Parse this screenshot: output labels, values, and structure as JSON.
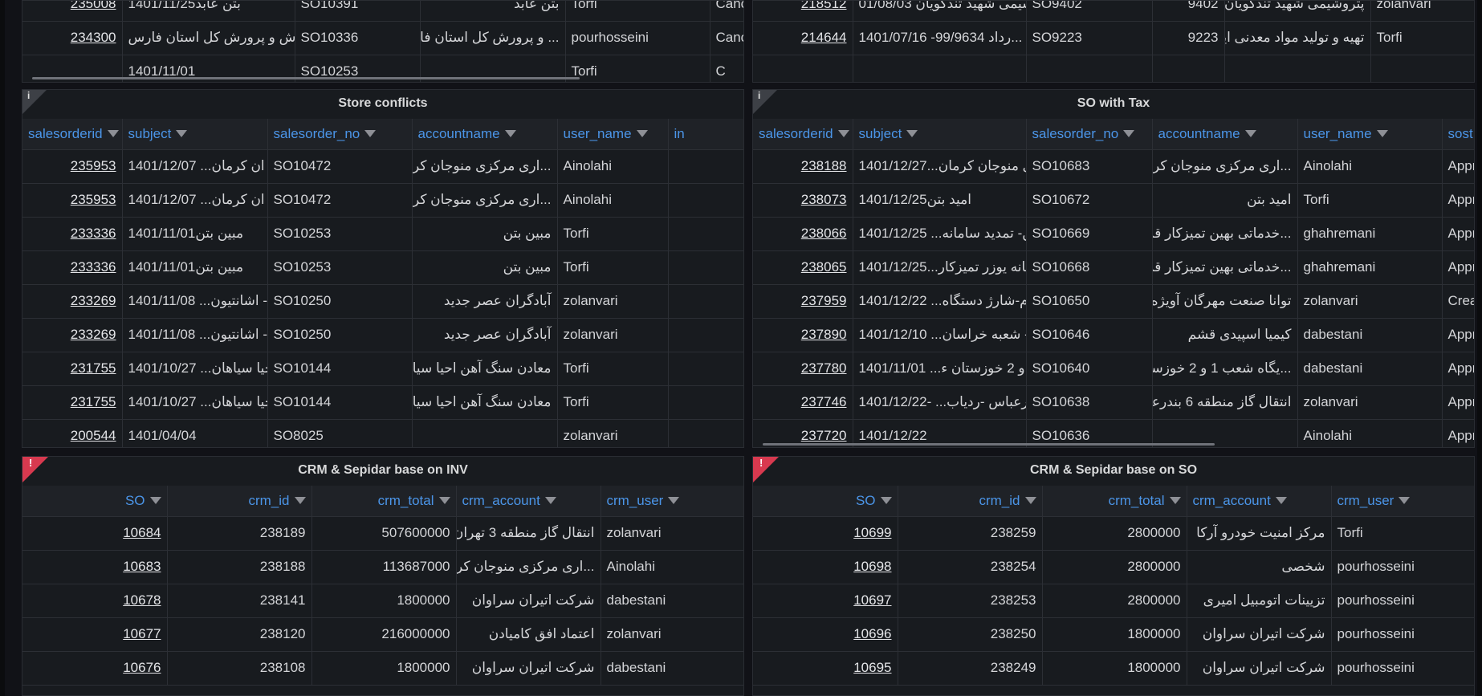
{
  "panels": {
    "top_left_partial": {
      "rows": [
        {
          "id": "235008",
          "subject": "1401/11/25بتن عابد",
          "so": "SO10391",
          "account": "بتن عابد",
          "user": "Torfi",
          "status": "Canc"
        },
        {
          "id": "234300",
          "subject": "آموزش و پرورش کل استان فارس...",
          "so": "SO10336",
          "account": "... و پرورش کل استان فارس",
          "user": "pourhosseini",
          "status": "Canc"
        },
        {
          "id": "",
          "subject": "1401/11/01",
          "so": "SO10253",
          "account": "",
          "user": "Torfi",
          "status": "C"
        }
      ]
    },
    "top_right_partial": {
      "rows": [
        {
          "id": "218512",
          "subject": "01/08/03 شیمی شهید تندگویان...",
          "so": "SO9402",
          "num": "9402",
          "account": "پتروشیمی شهید تندگویان",
          "user": "zolanvari"
        },
        {
          "id": "214644",
          "subject": "1401/07/16 -99/9634 رداد...",
          "so": "SO9223",
          "num": "9223",
          "account": "تهیه و تولید مواد معدنی ایران",
          "user": "Torfi"
        },
        {
          "id": "",
          "subject": "",
          "so": "",
          "num": "",
          "account": "",
          "user": ""
        }
      ]
    },
    "store_conflicts": {
      "title": "Store conflicts",
      "info_glyph": "i",
      "columns": [
        "salesorderid",
        "subject",
        "salesorder_no",
        "accountname",
        "user_name",
        "in"
      ],
      "rows": [
        {
          "id": "235953",
          "subject": "1401/12/07 ...ان کرمان",
          "so": "SO10472",
          "account": "...اری مرکزی منوجان کرمان",
          "user": "Ainolahi"
        },
        {
          "id": "235953",
          "subject": "1401/12/07 ...ان کرمان",
          "so": "SO10472",
          "account": "...اری مرکزی منوجان کرمان",
          "user": "Ainolahi"
        },
        {
          "id": "233336",
          "subject": "1401/11/01مبین بتن",
          "so": "SO10253",
          "account": "مبین بتن",
          "user": "Torfi"
        },
        {
          "id": "233336",
          "subject": "1401/11/01مبین بتن",
          "so": "SO10253",
          "account": "مبین بتن",
          "user": "Torfi"
        },
        {
          "id": "233269",
          "subject": "1401/11/08 ...د- اشانتیون",
          "so": "SO10250",
          "account": "آبادگران عصر جدید",
          "user": "zolanvari"
        },
        {
          "id": "233269",
          "subject": "1401/11/08 ...د- اشانتیون",
          "so": "SO10250",
          "account": "آبادگران عصر جدید",
          "user": "zolanvari"
        },
        {
          "id": "231755",
          "subject": "1401/10/27 ...حیا سیاهان",
          "so": "SO10144",
          "account": "معادن سنگ آهن احیا سیاهان",
          "user": "Torfi"
        },
        {
          "id": "231755",
          "subject": "1401/10/27 ...حیا سیاهان",
          "so": "SO10144",
          "account": "معادن سنگ آهن احیا سیاهان",
          "user": "Torfi"
        },
        {
          "id": "200544",
          "subject": "1401/04/04",
          "so": "SO8025",
          "account": "",
          "user": "zolanvari"
        }
      ]
    },
    "so_with_tax": {
      "title": "SO with Tax",
      "info_glyph": "i",
      "columns": [
        "salesorderid",
        "subject",
        "salesorder_no",
        "accountname",
        "user_name",
        "sost"
      ],
      "rows": [
        {
          "id": "238188",
          "subject": "1401/12/27...ی منوجان کرمان",
          "so": "SO10683",
          "account": "...اری مرکزی منوجان کرمان",
          "user": "Ainolahi",
          "status": "Appr"
        },
        {
          "id": "238073",
          "subject": "1401/12/25امید بتن",
          "so": "SO10672",
          "account": "امید بتن",
          "user": "Torfi",
          "status": "Appr"
        },
        {
          "id": "238066",
          "subject": "1401/12/25 ...وین- تمدید سامانه",
          "so": "SO10669",
          "account": "...خدماتی بهین تمیزکار قزوین",
          "user": "ghahremani",
          "status": "Appr"
        },
        {
          "id": "238065",
          "subject": "1401/12/25...مانه یوزر تمیزکار",
          "so": "SO10668",
          "account": "...خدماتی بهین تمیزکار قزوین",
          "user": "ghahremani",
          "status": "Appr"
        },
        {
          "id": "237959",
          "subject": "1401/12/22 ...یلام-شارژ دستگاه",
          "so": "SO10650",
          "account": "توانا صنعت مهرگان آویژه",
          "user": "zolanvari",
          "status": "Crea"
        },
        {
          "id": "237890",
          "subject": "1401/12/10 ...م - شعبه خراسان",
          "so": "SO10646",
          "account": "کیمیا اسپیدی قشم",
          "user": "dabestani",
          "status": "Appr"
        },
        {
          "id": "237780",
          "subject": "1401/11/01 ...و 2 خوزستان ء",
          "so": "SO10640",
          "account": "...یگاه شعب 1 و 2 خوزستان",
          "user": "dabestani",
          "status": "Appr"
        },
        {
          "id": "237746",
          "subject": "1401/12/22- ...بندرعباس -ردیاب",
          "so": "SO10638",
          "account": "انتقال گاز منطقه 6 بندرعباس",
          "user": "zolanvari",
          "status": "Appr"
        },
        {
          "id": "237720",
          "subject": "1401/12/22",
          "so": "SO10636",
          "account": "",
          "user": "Ainolahi",
          "status": "Appr"
        }
      ]
    },
    "crm_inv": {
      "title": "CRM & Sepidar base on INV",
      "error_glyph": "!",
      "columns": [
        "SO",
        "crm_id",
        "crm_total",
        "crm_account",
        "crm_user"
      ],
      "rows": [
        {
          "so": "10684",
          "crm_id": "238189",
          "total": "507600000",
          "account": "انتقال گاز منطقه 3 تهران",
          "user": "zolanvari"
        },
        {
          "so": "10683",
          "crm_id": "238188",
          "total": "113687000",
          "account": "...اری مرکزی منوجان کرمان",
          "user": "Ainolahi"
        },
        {
          "so": "10678",
          "crm_id": "238141",
          "total": "1800000",
          "account": "شرکت اتیران سراوان",
          "user": "dabestani"
        },
        {
          "so": "10677",
          "crm_id": "238120",
          "total": "216000000",
          "account": "اعتماد افق کامیادن",
          "user": "zolanvari"
        },
        {
          "so": "10676",
          "crm_id": "238108",
          "total": "1800000",
          "account": "شرکت اتیران سراوان",
          "user": "dabestani"
        }
      ]
    },
    "crm_so": {
      "title": "CRM & Sepidar base on SO",
      "error_glyph": "!",
      "columns": [
        "SO",
        "crm_id",
        "crm_total",
        "crm_account",
        "crm_user"
      ],
      "rows": [
        {
          "so": "10699",
          "crm_id": "238259",
          "total": "2800000",
          "account": "مرکز امنیت خودرو آرکا",
          "user": "Torfi"
        },
        {
          "so": "10698",
          "crm_id": "238254",
          "total": "2800000",
          "account": "شخصی",
          "user": "pourhosseini"
        },
        {
          "so": "10697",
          "crm_id": "238253",
          "total": "2800000",
          "account": "تزیینات اتومبیل امیری",
          "user": "pourhosseini"
        },
        {
          "so": "10696",
          "crm_id": "238250",
          "total": "1800000",
          "account": "شرکت اتیران سراوان",
          "user": "pourhosseini"
        },
        {
          "so": "10695",
          "crm_id": "238249",
          "total": "1800000",
          "account": "شرکت اتیران سراوان",
          "user": "pourhosseini"
        }
      ]
    }
  }
}
